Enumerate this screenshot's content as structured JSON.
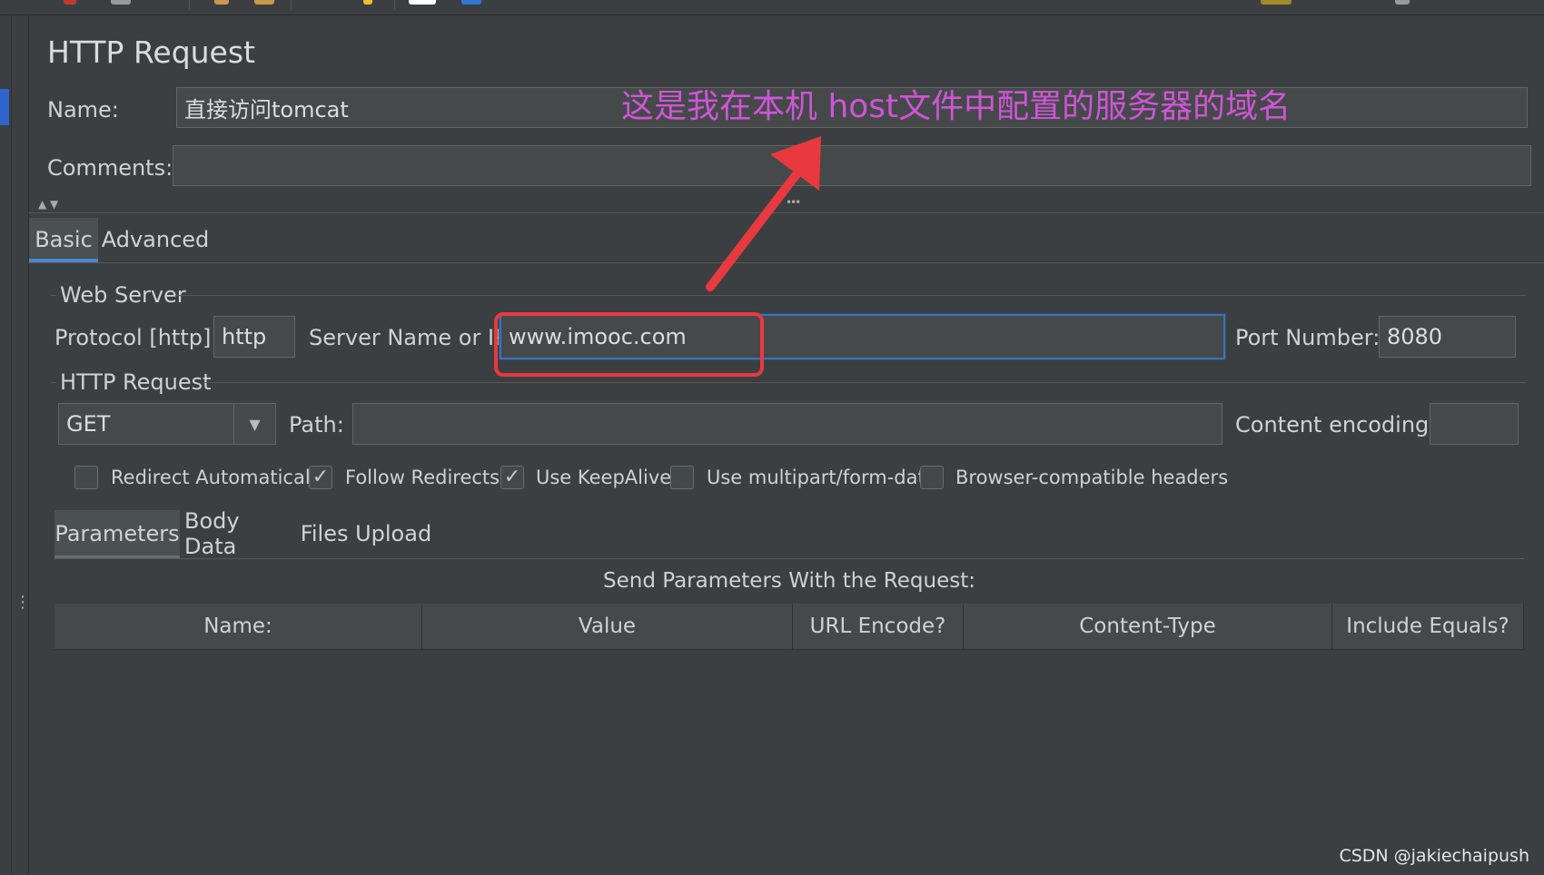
{
  "panel": {
    "title": "HTTP Request",
    "name_label": "Name:",
    "name_value": "直接访问tomcat",
    "comments_label": "Comments:",
    "comments_value": ""
  },
  "tabs": {
    "items": [
      "Basic",
      "Advanced"
    ],
    "active": "Basic"
  },
  "web_server": {
    "group_title": "Web Server",
    "protocol_label": "Protocol [http]:",
    "protocol_value": "http",
    "server_label": "Server Name or IP:",
    "server_value": "www.imooc.com",
    "port_label": "Port Number:",
    "port_value": "8080"
  },
  "http_request": {
    "group_title": "HTTP Request",
    "method_value": "GET",
    "path_label": "Path:",
    "path_value": "",
    "encoding_label": "Content encoding:",
    "encoding_value": ""
  },
  "options": [
    {
      "label": "Redirect Automatically",
      "checked": false
    },
    {
      "label": "Follow Redirects",
      "checked": true
    },
    {
      "label": "Use KeepAlive",
      "checked": true
    },
    {
      "label": "Use multipart/form-data",
      "checked": false
    },
    {
      "label": "Browser-compatible headers",
      "checked": false
    }
  ],
  "sub_tabs": {
    "items": [
      "Parameters",
      "Body Data",
      "Files Upload"
    ],
    "active": "Parameters"
  },
  "parameters": {
    "caption": "Send Parameters With the Request:",
    "columns": [
      "Name:",
      "Value",
      "URL Encode?",
      "Content-Type",
      "Include Equals?"
    ]
  },
  "annotation": {
    "text": "这是我在本机 host文件中配置的服务器的域名",
    "color": "#cf55d6",
    "highlight_color": "#e8393f"
  },
  "watermark": "CSDN @jakiechaipush",
  "colors": {
    "background": "#3c3f41",
    "accent": "#4a88c7",
    "field_bg": "#45494a"
  }
}
